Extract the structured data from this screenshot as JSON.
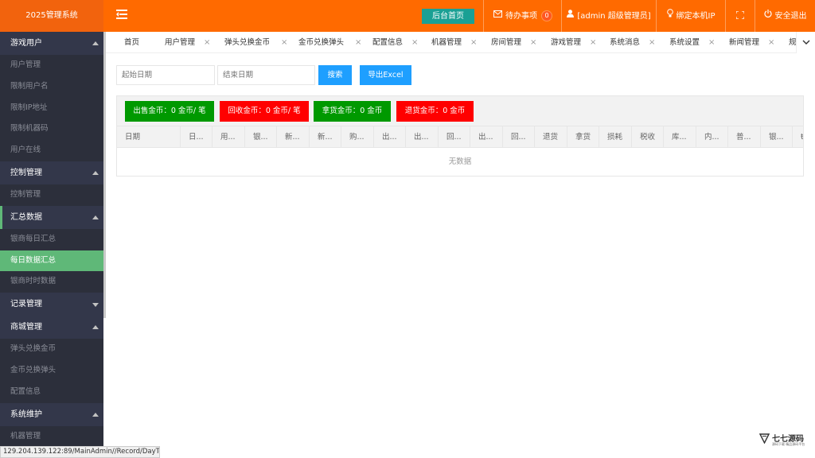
{
  "app": {
    "title": "2025管理系统"
  },
  "header": {
    "home_button": "后台首页",
    "todo_label": "待办事项",
    "todo_count": "0",
    "user_label": "[admin 超级管理员]",
    "bind_ip_label": "绑定本机IP",
    "logout_label": "安全退出"
  },
  "sidebar": {
    "groups": [
      {
        "label": "游戏用户",
        "items": [
          "用户管理",
          "限制用户名",
          "限制IP地址",
          "限制机器码",
          "用户在线"
        ]
      },
      {
        "label": "控制管理",
        "items": [
          "控制管理"
        ]
      },
      {
        "label": "汇总数据",
        "items": [
          "银商每日汇总",
          "每日数据汇总",
          "银商时时数据"
        ]
      },
      {
        "label": "记录管理",
        "items": []
      },
      {
        "label": "商城管理",
        "items": [
          "弹头兑换金币",
          "金币兑换弹头",
          "配置信息"
        ]
      },
      {
        "label": "系统维护",
        "items": [
          "机器管理"
        ]
      }
    ]
  },
  "tabs": [
    "首页",
    "用户管理",
    "弹头兑换金币",
    "金币兑换弹头",
    "配置信息",
    "机器管理",
    "房间管理",
    "游戏管理",
    "系统消息",
    "系统设置",
    "新闻管理",
    "规"
  ],
  "filters": {
    "start_placeholder": "起始日期",
    "end_placeholder": "结束日期",
    "search_label": "搜索",
    "export_label": "导出Excel"
  },
  "stats": {
    "sell": "出售金币：0 金币/ 笔",
    "recycle": "回收金币：0 金币/ 笔",
    "take": "拿货金币：0 金币",
    "refund": "退货金币：0 金币"
  },
  "table": {
    "columns": [
      "日期",
      "日...",
      "用...",
      "银...",
      "新...",
      "新...",
      "购...",
      "出...",
      "出...",
      "回...",
      "出...",
      "回...",
      "退货",
      "拿货",
      "损耗",
      "税收",
      "库...",
      "内...",
      "普...",
      "银...",
      "ŧ"
    ],
    "empty_text": "无数据"
  },
  "statusbar": {
    "url": "129.204.139.122:89/MainAdmin//Record/DayTotal.html"
  },
  "watermark": {
    "title": "七七源码",
    "subtitle": "源码下载 精品源码平台"
  },
  "colors": {
    "topbar": "#ff6a00",
    "sidebar": "#393d49",
    "active_item": "#5fb878",
    "home_button": "#1aa094",
    "primary_button": "#1e9fff",
    "stat_green": "#009900",
    "stat_red": "#ff0000"
  }
}
